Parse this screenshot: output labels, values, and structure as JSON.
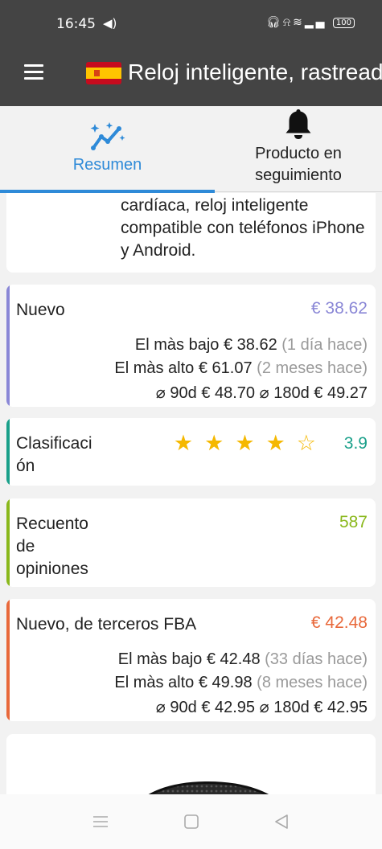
{
  "status_bar": {
    "time": "16:45",
    "battery": "100"
  },
  "app_bar": {
    "title": "Reloj inteligente, rastreador de actividad"
  },
  "tabs": [
    {
      "label": "Resumen",
      "active": true
    },
    {
      "label": "Producto en seguimiento",
      "active": false
    }
  ],
  "description": {
    "text": "cardíaca, reloj inteligente compatible con teléfonos iPhone y Android."
  },
  "new_price": {
    "label": "Nuevo",
    "value": "€ 38.62",
    "accent": "#8a87d6",
    "lowest_label": "El màs bajo",
    "lowest_value": "€ 38.62",
    "lowest_when": "(1 día hace)",
    "highest_label": "El màs alto",
    "highest_value": "€ 61.07",
    "highest_when": "(2 meses hace)",
    "avg90_label": "⌀ 90d",
    "avg90_value": "€ 48.70",
    "avg180_label": "⌀ 180d",
    "avg180_value": "€ 49.27"
  },
  "rating": {
    "label": "Clasificaci ón",
    "label_line1": "Clasificaci",
    "label_line2": "ón",
    "value": "3.9",
    "stars": 3.9,
    "accent": "#1aa08a"
  },
  "review_count": {
    "label_lines": [
      "Recuento",
      "de",
      "opiniones"
    ],
    "value": "587",
    "accent": "#8ab81c"
  },
  "fba": {
    "label": "Nuevo, de terceros FBA",
    "value": "€ 42.48",
    "accent": "#e8683a",
    "lowest_label": "El màs bajo",
    "lowest_value": "€ 42.48",
    "lowest_when": "(33 días hace)",
    "highest_label": "El màs alto",
    "highest_value": "€ 49.98",
    "highest_when": "(8 meses hace)",
    "avg90_label": "⌀ 90d",
    "avg90_value": "€ 42.95",
    "avg180_label": "⌀ 180d",
    "avg180_value": "€ 42.95"
  }
}
